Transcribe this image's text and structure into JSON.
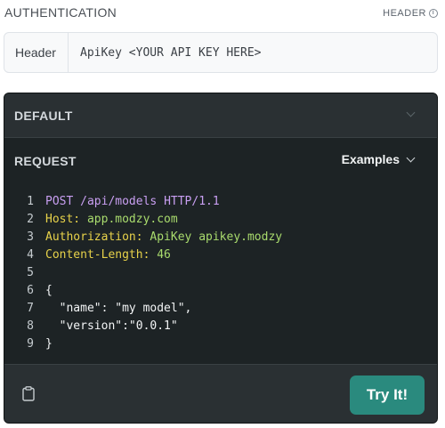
{
  "auth": {
    "title": "AUTHENTICATION",
    "type_tag": "HEADER",
    "key": "Header",
    "value": "ApiKey <YOUR API KEY HERE>"
  },
  "panel": {
    "default_label": "DEFAULT",
    "request_label": "REQUEST",
    "examples_label": "Examples",
    "try_label": "Try It!"
  },
  "code": {
    "line_numbers": [
      "1",
      "2",
      "3",
      "4",
      "5",
      "6",
      "7",
      "8",
      "9"
    ],
    "l1_method": "POST",
    "l1_path": "/api/models",
    "l1_proto": "HTTP/1.1",
    "l2_key": "Host:",
    "l2_val": "app.modzy.com",
    "l3_key": "Authorization:",
    "l3_val": "ApiKey apikey.modzy",
    "l4_key": "Content-Length:",
    "l4_val": "46",
    "l6": "{",
    "l7": "  \"name\": \"my model\",",
    "l8": "  \"version\":\"0.0.1\"",
    "l9": "}"
  },
  "colors": {
    "panel_bg": "#1d2325",
    "method": "#c99ff2",
    "header_key": "#e7d24a",
    "header_value": "#a9db6d",
    "try_button": "#2a8a7e"
  },
  "icons": [
    "info-icon",
    "chevron-down-icon",
    "clipboard-icon"
  ]
}
